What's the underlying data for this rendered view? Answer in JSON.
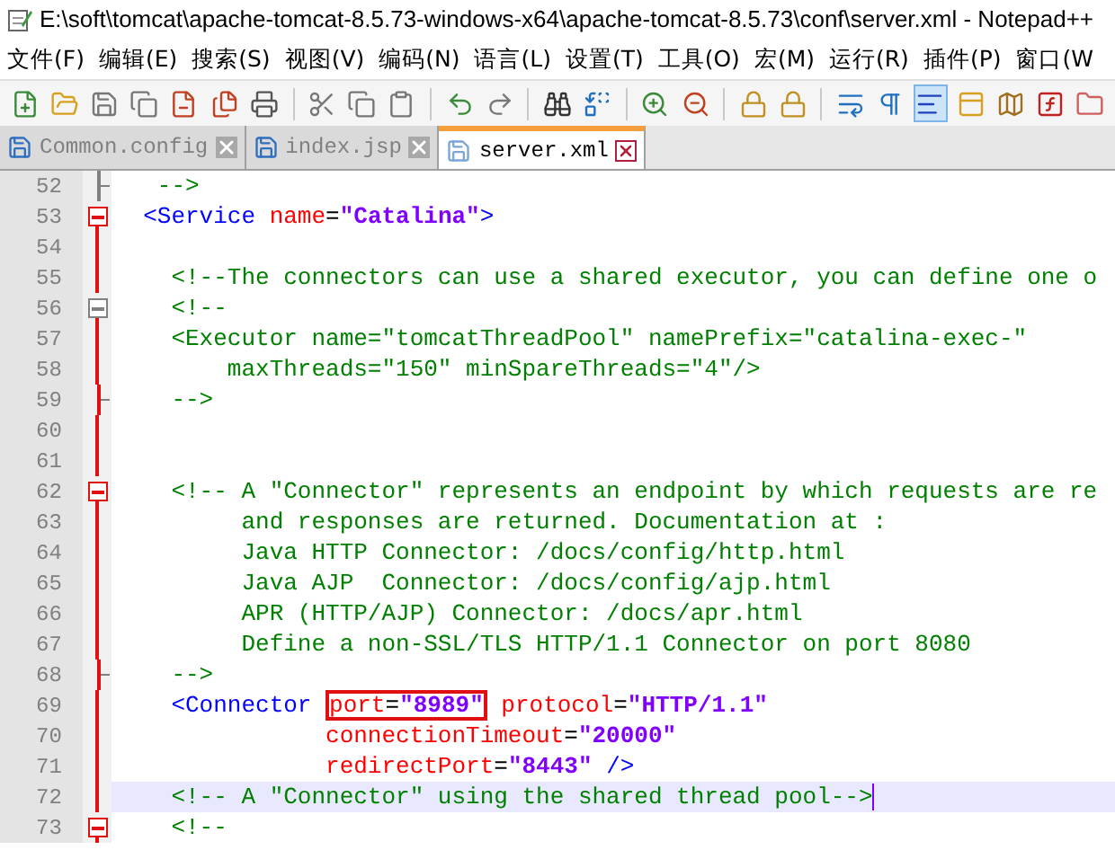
{
  "window": {
    "title": "E:\\soft\\tomcat\\apache-tomcat-8.5.73-windows-x64\\apache-tomcat-8.5.73\\conf\\server.xml - Notepad++"
  },
  "menu": [
    "文件(F)",
    "编辑(E)",
    "搜索(S)",
    "视图(V)",
    "编码(N)",
    "语言(L)",
    "设置(T)",
    "工具(O)",
    "宏(M)",
    "运行(R)",
    "插件(P)",
    "窗口(W"
  ],
  "toolbar": [
    {
      "kind": "new",
      "selected": false
    },
    {
      "kind": "open",
      "selected": false
    },
    {
      "kind": "save",
      "selected": false
    },
    {
      "kind": "saveall",
      "selected": false
    },
    {
      "kind": "close",
      "selected": false
    },
    {
      "kind": "closeall",
      "selected": false
    },
    {
      "kind": "print",
      "selected": false
    },
    {
      "kind": "sep"
    },
    {
      "kind": "cut",
      "selected": false
    },
    {
      "kind": "copy",
      "selected": false
    },
    {
      "kind": "paste",
      "selected": false
    },
    {
      "kind": "sep"
    },
    {
      "kind": "undo",
      "selected": false
    },
    {
      "kind": "redo",
      "selected": false
    },
    {
      "kind": "sep"
    },
    {
      "kind": "find",
      "selected": false
    },
    {
      "kind": "replace",
      "selected": false
    },
    {
      "kind": "sep"
    },
    {
      "kind": "zoomin",
      "selected": false
    },
    {
      "kind": "zoomout",
      "selected": false
    },
    {
      "kind": "sep"
    },
    {
      "kind": "syncv",
      "selected": false
    },
    {
      "kind": "synch",
      "selected": false
    },
    {
      "kind": "sep"
    },
    {
      "kind": "wrap",
      "selected": false
    },
    {
      "kind": "pilcrow",
      "selected": false
    },
    {
      "kind": "guide",
      "selected": true
    },
    {
      "kind": "panel",
      "selected": false
    },
    {
      "kind": "map",
      "selected": false
    },
    {
      "kind": "func",
      "selected": false
    },
    {
      "kind": "folder",
      "selected": false
    }
  ],
  "tabs": [
    {
      "label": "Common.config",
      "selected": false
    },
    {
      "label": "index.jsp",
      "selected": false
    },
    {
      "label": "server.xml",
      "selected": true
    }
  ],
  "lines": [
    {
      "number": "52",
      "fold": {
        "kind": "end_gray"
      },
      "current": false,
      "tokens": [
        {
          "kind": "c",
          "t": "   -->"
        }
      ]
    },
    {
      "number": "53",
      "fold": {
        "kind": "open_red"
      },
      "current": false,
      "tokens": [
        {
          "kind": "tag",
          "t": "  <Service"
        },
        {
          "kind": "attr",
          "t": " name"
        },
        {
          "kind": "p",
          "t": "="
        },
        {
          "kind": "val",
          "t": "\"Catalina\""
        },
        {
          "kind": "tag",
          "t": ">"
        }
      ]
    },
    {
      "number": "54",
      "fold": {
        "kind": "line"
      },
      "current": false
    },
    {
      "number": "55",
      "fold": {
        "kind": "line"
      },
      "current": false,
      "tokens": [
        {
          "kind": "c",
          "t": "    <!--The connectors can use a shared executor, you can define one o"
        }
      ]
    },
    {
      "number": "56",
      "fold": {
        "kind": "open_gray"
      },
      "current": false,
      "tokens": [
        {
          "kind": "c",
          "t": "    <!--"
        }
      ]
    },
    {
      "number": "57",
      "fold": {
        "kind": "line"
      },
      "current": false,
      "tokens": [
        {
          "kind": "c",
          "t": "    <Executor name=\"tomcatThreadPool\" namePrefix=\"catalina-exec-\""
        }
      ]
    },
    {
      "number": "58",
      "fold": {
        "kind": "line"
      },
      "current": false,
      "tokens": [
        {
          "kind": "c",
          "t": "        maxThreads=\"150\" minSpareThreads=\"4\"/>"
        }
      ]
    },
    {
      "number": "59",
      "fold": {
        "kind": "end"
      },
      "current": false,
      "tokens": [
        {
          "kind": "c",
          "t": "    -->"
        }
      ]
    },
    {
      "number": "60",
      "fold": {
        "kind": "line"
      },
      "current": false
    },
    {
      "number": "61",
      "fold": {
        "kind": "line"
      },
      "current": false
    },
    {
      "number": "62",
      "fold": {
        "kind": "open_red"
      },
      "current": false,
      "tokens": [
        {
          "kind": "c",
          "t": "    <!-- A \"Connector\" represents an endpoint by which requests are re"
        }
      ]
    },
    {
      "number": "63",
      "fold": {
        "kind": "line"
      },
      "current": false,
      "tokens": [
        {
          "kind": "c",
          "t": "         and responses are returned. Documentation at :"
        }
      ]
    },
    {
      "number": "64",
      "fold": {
        "kind": "line"
      },
      "current": false,
      "tokens": [
        {
          "kind": "c",
          "t": "         Java HTTP Connector: /docs/config/http.html"
        }
      ]
    },
    {
      "number": "65",
      "fold": {
        "kind": "line"
      },
      "current": false,
      "tokens": [
        {
          "kind": "c",
          "t": "         Java AJP  Connector: /docs/config/ajp.html"
        }
      ]
    },
    {
      "number": "66",
      "fold": {
        "kind": "line"
      },
      "current": false,
      "tokens": [
        {
          "kind": "c",
          "t": "         APR (HTTP/AJP) Connector: /docs/apr.html"
        }
      ]
    },
    {
      "number": "67",
      "fold": {
        "kind": "line"
      },
      "current": false,
      "tokens": [
        {
          "kind": "c",
          "t": "         Define a non-SSL/TLS HTTP/1.1 Connector on port 8080"
        }
      ]
    },
    {
      "number": "68",
      "fold": {
        "kind": "end"
      },
      "current": false,
      "tokens": [
        {
          "kind": "c",
          "t": "    -->"
        }
      ]
    },
    {
      "number": "69",
      "fold": {
        "kind": "line"
      },
      "current": false,
      "tokens": [
        {
          "kind": "tag",
          "t": "    <Connector "
        },
        {
          "kind": "attr",
          "t": "port",
          "box": true
        },
        {
          "kind": "p",
          "t": "=",
          "box": true
        },
        {
          "kind": "val",
          "t": "\"8989\"",
          "box": true
        },
        {
          "kind": "attr",
          "t": " protocol"
        },
        {
          "kind": "p",
          "t": "="
        },
        {
          "kind": "val",
          "t": "\"HTTP/1.1\""
        }
      ]
    },
    {
      "number": "70",
      "fold": {
        "kind": "line"
      },
      "current": false,
      "tokens": [
        {
          "kind": "attr",
          "t": "               connectionTimeout"
        },
        {
          "kind": "p",
          "t": "="
        },
        {
          "kind": "val",
          "t": "\"20000\""
        }
      ]
    },
    {
      "number": "71",
      "fold": {
        "kind": "line"
      },
      "current": false,
      "tokens": [
        {
          "kind": "attr",
          "t": "               redirectPort"
        },
        {
          "kind": "p",
          "t": "="
        },
        {
          "kind": "val",
          "t": "\"8443\""
        },
        {
          "kind": "tag",
          "t": " />"
        }
      ]
    },
    {
      "number": "72",
      "fold": {
        "kind": "line"
      },
      "current": true,
      "tokens": [
        {
          "kind": "c",
          "t": "    <!-- A \"Connector\" using the shared thread pool-->"
        }
      ]
    },
    {
      "number": "73",
      "fold": {
        "kind": "open_red"
      },
      "current": false,
      "tokens": [
        {
          "kind": "c",
          "t": "    <!--"
        }
      ]
    }
  ]
}
